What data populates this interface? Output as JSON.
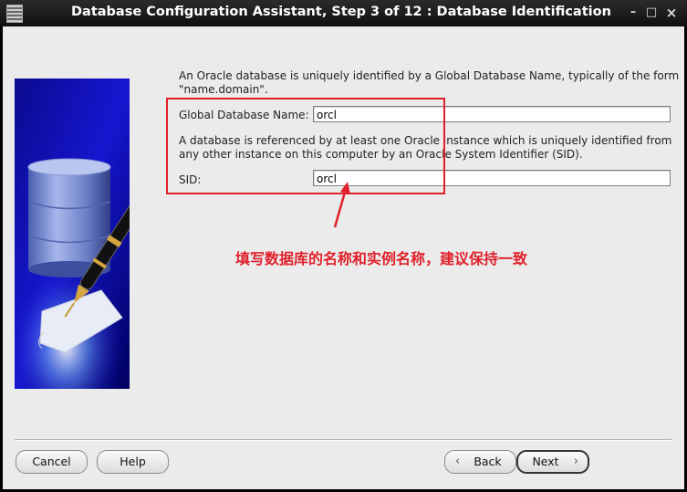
{
  "window": {
    "title": "Database Configuration Assistant, Step 3 of 12 : Database Identification",
    "controls": {
      "minimize": "–",
      "maximize": "□",
      "close": "×"
    }
  },
  "description": {
    "line1": "An Oracle database is uniquely identified by a Global Database Name, typically of the form",
    "line2": "\"name.domain\".",
    "sid_line1": "A database is referenced by at least one Oracle instance which is uniquely identified from",
    "sid_line2": "any other instance on this computer by an Oracle System Identifier (SID)."
  },
  "fields": {
    "global_db_name": {
      "label": "Global Database Name:",
      "value": "orcl"
    },
    "sid": {
      "label": "SID:",
      "value": "orcl"
    }
  },
  "annotation": {
    "text": "填写数据库的名称和实例名称，建议保持一致",
    "color": "#e0202a"
  },
  "buttons": {
    "cancel": "Cancel",
    "help": "Help",
    "back": "Back",
    "next": "Next"
  },
  "icons": {
    "side_image": "database-and-pen-illustration",
    "back": "chevron-left-icon",
    "next": "chevron-right-icon"
  }
}
